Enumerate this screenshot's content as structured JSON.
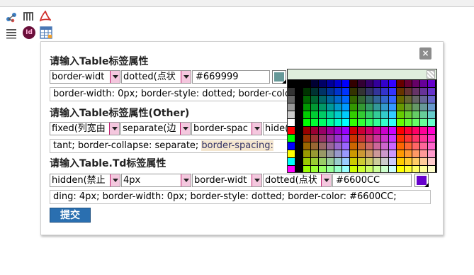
{
  "toolbar": {
    "icons": [
      "share-icon",
      "grip-icon",
      "pdf-icon",
      "list-icon",
      "indesign-icon",
      "table-icon"
    ],
    "indesign_badge": "Id"
  },
  "dialog": {
    "close_label": "×",
    "section1": {
      "title": "请输入Table标签属性",
      "prop_select": "border-widt",
      "style_select": "dotted(点状",
      "color_value": "#669999",
      "color_swatch": "#669999",
      "css_text": "border-width: 0px; border-style: dotted; border-color"
    },
    "section2": {
      "title": "请输入Table标签属性(Other)",
      "layout_select": "fixed(列宽由",
      "collapse_select": "separate(边",
      "spacing_select": "border-spac",
      "empty_select": "hide(",
      "css_before": "tant; border-collapse: separate; ",
      "css_highlight": "border-spacing: "
    },
    "section3": {
      "title": "请输入Table.Td标签属性",
      "overflow_select": "hidden(禁止",
      "size_select": "4px",
      "prop_select": "border-widt",
      "style_select": "dotted(点状",
      "color_value": "#6600CC",
      "color_swatch": "#6600CC",
      "css_text": "ding: 4px; border-width: 0px; border-style: dotted; border-color: #6600CC;"
    },
    "submit_label": "提交"
  },
  "color_picker": {
    "gray_column": [
      "#000000",
      "#333333",
      "#666666",
      "#999999",
      "#cccccc",
      "#ffffff",
      "#ff0000",
      "#00ff00",
      "#0000ff",
      "#ffff00",
      "#00ffff",
      "#ff00ff"
    ],
    "red_levels": [
      "00",
      "33",
      "66",
      "99",
      "cc",
      "ff"
    ],
    "green_levels": [
      "00",
      "33",
      "66",
      "99",
      "cc",
      "ff"
    ],
    "blue_levels": [
      "00",
      "33",
      "66",
      "99",
      "cc",
      "ff"
    ]
  }
}
